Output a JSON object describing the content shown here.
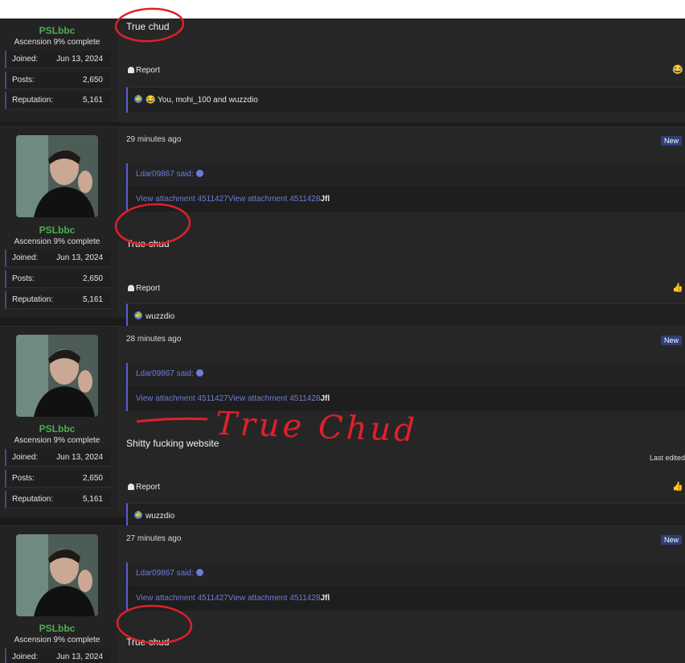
{
  "posts": [
    {
      "username": "PSLbbc",
      "user_title": "Ascension 9% complete",
      "stats": [
        {
          "label": "Joined:",
          "value": "Jun 13, 2024"
        },
        {
          "label": "Posts:",
          "value": "2,650"
        },
        {
          "label": "Reputation:",
          "value": "5,161"
        }
      ],
      "message": "True chud",
      "report_label": "Report",
      "reactions_text": "😂 You, mohi_100 and wuzzdio"
    },
    {
      "time": "29 minutes ago",
      "badge": "New",
      "username": "PSLbbc",
      "user_title": "Ascension 9% complete",
      "stats": [
        {
          "label": "Joined:",
          "value": "Jun 13, 2024"
        },
        {
          "label": "Posts:",
          "value": "2,650"
        },
        {
          "label": "Reputation:",
          "value": "5,161"
        }
      ],
      "quote_author": "Ldar09867 said:",
      "attachments": "View attachment 4511427View attachment 4511428",
      "attachment_suffix": "Jfl",
      "message": "True chud",
      "report_label": "Report",
      "reactions_text": "wuzzdio"
    },
    {
      "time": "28 minutes ago",
      "badge": "New",
      "username": "PSLbbc",
      "user_title": "Ascension 9% complete",
      "stats": [
        {
          "label": "Joined:",
          "value": "Jun 13, 2024"
        },
        {
          "label": "Posts:",
          "value": "2,650"
        },
        {
          "label": "Reputation:",
          "value": "5,161"
        }
      ],
      "quote_author": "Ldar09867 said:",
      "attachments": "View attachment 4511427View attachment 4511428",
      "attachment_suffix": "Jfl",
      "message": "Shitty fucking website",
      "last_edited": "Last edited",
      "report_label": "Report",
      "reactions_text": "wuzzdio",
      "handwritten": "True Chud"
    },
    {
      "time": "27 minutes ago",
      "badge": "New",
      "username": "PSLbbc",
      "user_title": "Ascension 9% complete",
      "stats": [
        {
          "label": "Joined:",
          "value": "Jun 13, 2024"
        }
      ],
      "quote_author": "Ldar09867 said:",
      "attachments": "View attachment 4511427View attachment 4511428",
      "attachment_suffix": "Jfl",
      "message": "True chud"
    }
  ],
  "colors": {
    "username": "#4caf50",
    "link": "#6f7bd8",
    "annotation": "#e0202a",
    "badge": "#2f3f7a"
  }
}
